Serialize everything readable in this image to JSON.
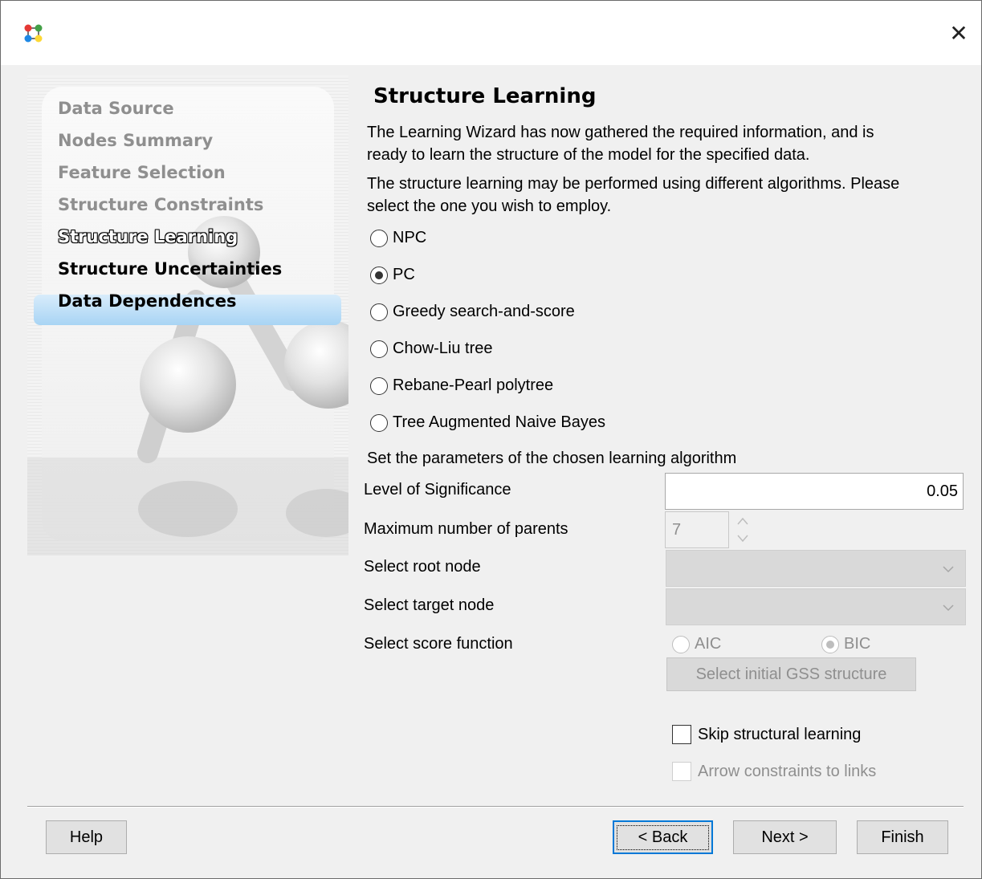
{
  "window": {
    "close_glyph": "✕",
    "icon": "network-nodes-icon"
  },
  "sidebar": {
    "steps": [
      {
        "label": "Data Source",
        "state": "done"
      },
      {
        "label": "Nodes Summary",
        "state": "done"
      },
      {
        "label": "Feature Selection",
        "state": "done"
      },
      {
        "label": "Structure Constraints",
        "state": "done"
      },
      {
        "label": "Structure Learning",
        "state": "current"
      },
      {
        "label": "Structure Uncertainties",
        "state": "todo"
      },
      {
        "label": "Data Dependences",
        "state": "todo"
      }
    ],
    "highlight_color": "#b3dbf7"
  },
  "main": {
    "title": "Structure Learning",
    "intro_line1": "The Learning Wizard has now gathered the required information, and is",
    "intro_line2": "ready to learn the structure of the model for the specified data.",
    "algo_line1": "The structure learning may be performed using different algorithms. Please",
    "algo_line2": "select the one you wish to employ.",
    "algorithms": [
      {
        "label": "NPC",
        "selected": false
      },
      {
        "label": "PC",
        "selected": true
      },
      {
        "label": "Greedy search-and-score",
        "selected": false
      },
      {
        "label": "Chow-Liu tree",
        "selected": false
      },
      {
        "label": "Rebane-Pearl polytree",
        "selected": false
      },
      {
        "label": "Tree Augmented Naive Bayes",
        "selected": false
      }
    ],
    "params_heading": "Set the parameters of the chosen learning algorithm",
    "params": {
      "significance_label": "Level of Significance",
      "significance_value": "0.05",
      "max_parents_label": "Maximum number of parents",
      "max_parents_value": "7",
      "root_node_label": "Select root node",
      "target_node_label": "Select target node",
      "score_function_label": "Select score function",
      "score_aic": "AIC",
      "score_bic": "BIC",
      "score_selected": "BIC",
      "gss_button": "Select initial GSS structure"
    },
    "skip_learning_label": "Skip structural learning",
    "skip_learning_checked": false,
    "arrow_constraints_label": "Arrow constraints to links",
    "arrow_constraints_checked": false
  },
  "footer": {
    "help": "Help",
    "back": "< Back",
    "next": "Next >",
    "finish": "Finish"
  }
}
